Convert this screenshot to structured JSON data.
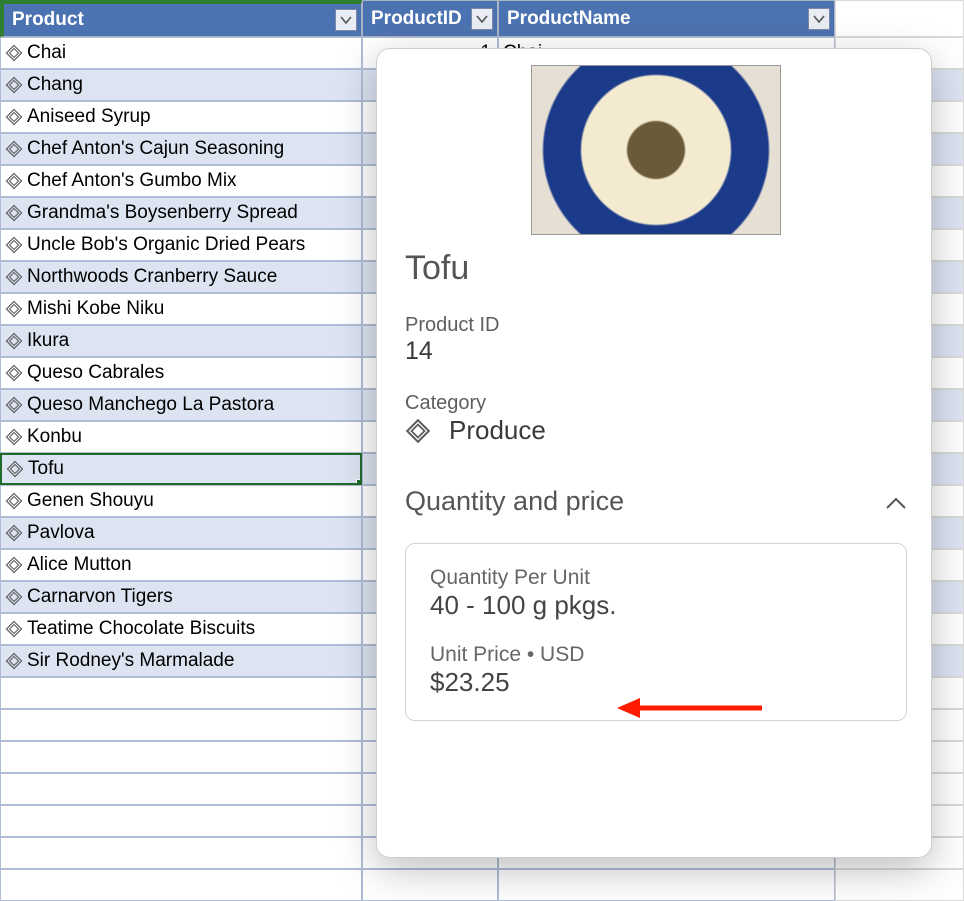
{
  "headers": {
    "product": "Product",
    "product_id": "ProductID",
    "product_name": "ProductName"
  },
  "visible_pid": "1",
  "visible_pname": "Chai",
  "products": [
    "Chai",
    "Chang",
    "Aniseed Syrup",
    "Chef Anton's Cajun Seasoning",
    "Chef Anton's Gumbo Mix",
    "Grandma's Boysenberry Spread",
    "Uncle Bob's Organic Dried Pears",
    "Northwoods Cranberry Sauce",
    "Mishi Kobe Niku",
    "Ikura",
    "Queso Cabrales",
    "Queso Manchego La Pastora",
    "Konbu",
    "Tofu",
    "Genen Shouyu",
    "Pavlova",
    "Alice Mutton",
    "Carnarvon Tigers",
    "Teatime Chocolate Biscuits",
    "Sir Rodney's Marmalade"
  ],
  "selected_index": 13,
  "card": {
    "title": "Tofu",
    "product_id_label": "Product ID",
    "product_id_value": "14",
    "category_label": "Category",
    "category_value": "Produce",
    "section_title": "Quantity and price",
    "qpu_label": "Quantity Per Unit",
    "qpu_value": "40 - 100 g pkgs.",
    "unitprice_label": "Unit Price • USD",
    "unitprice_value": "$23.25"
  }
}
